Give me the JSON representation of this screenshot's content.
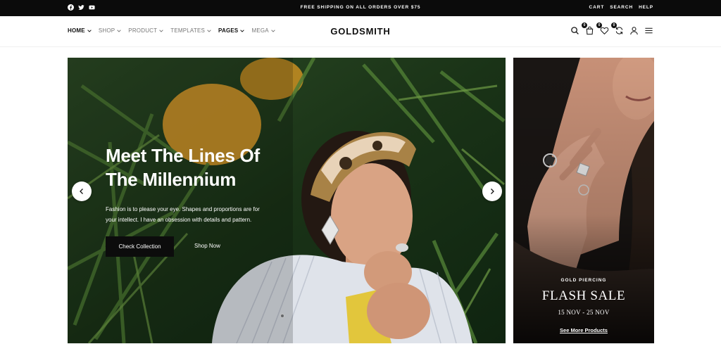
{
  "topbar": {
    "social": [
      "facebook-icon",
      "twitter-icon",
      "youtube-icon"
    ],
    "promo": "FREE SHIPPING ON ALL ORDERS OVER $75",
    "links": [
      "CART",
      "SEARCH",
      "HELP"
    ]
  },
  "header": {
    "nav": [
      {
        "label": "HOME",
        "active": true
      },
      {
        "label": "SHOP",
        "active": false
      },
      {
        "label": "PRODUCT",
        "active": false
      },
      {
        "label": "TEMPLATES",
        "active": false
      },
      {
        "label": "PAGES",
        "active": true
      },
      {
        "label": "MEGA",
        "active": false
      }
    ],
    "logo": "GOLDSMITH",
    "icons": [
      "search-icon",
      "cart-icon",
      "wishlist-icon",
      "compare-icon",
      "user-icon",
      "menu-icon"
    ],
    "badges": {
      "cart": "0",
      "wishlist": "0",
      "compare": "0"
    }
  },
  "hero": {
    "title_line1": "Meet The Lines Of",
    "title_line2": "The Millennium",
    "text_line1": "Fashion is to please your eye. Shapes and proportions are for",
    "text_line2": "your intellect. I have an obsession with details and pattern.",
    "primary_button": "Check Collection",
    "secondary_link": "Shop Now",
    "icons": [
      "chevron-left-icon",
      "chevron-right-icon"
    ]
  },
  "side_banner": {
    "kicker": "GOLD PIERCING",
    "title": "FLASH SALE",
    "dates": "15 NOV - 25 NOV",
    "link": "See More Products"
  },
  "colors": {
    "topbar_bg": "#0b0b0b",
    "text_dark": "#111111",
    "nav_muted": "#777777",
    "button_bg": "#0c0c0c"
  }
}
